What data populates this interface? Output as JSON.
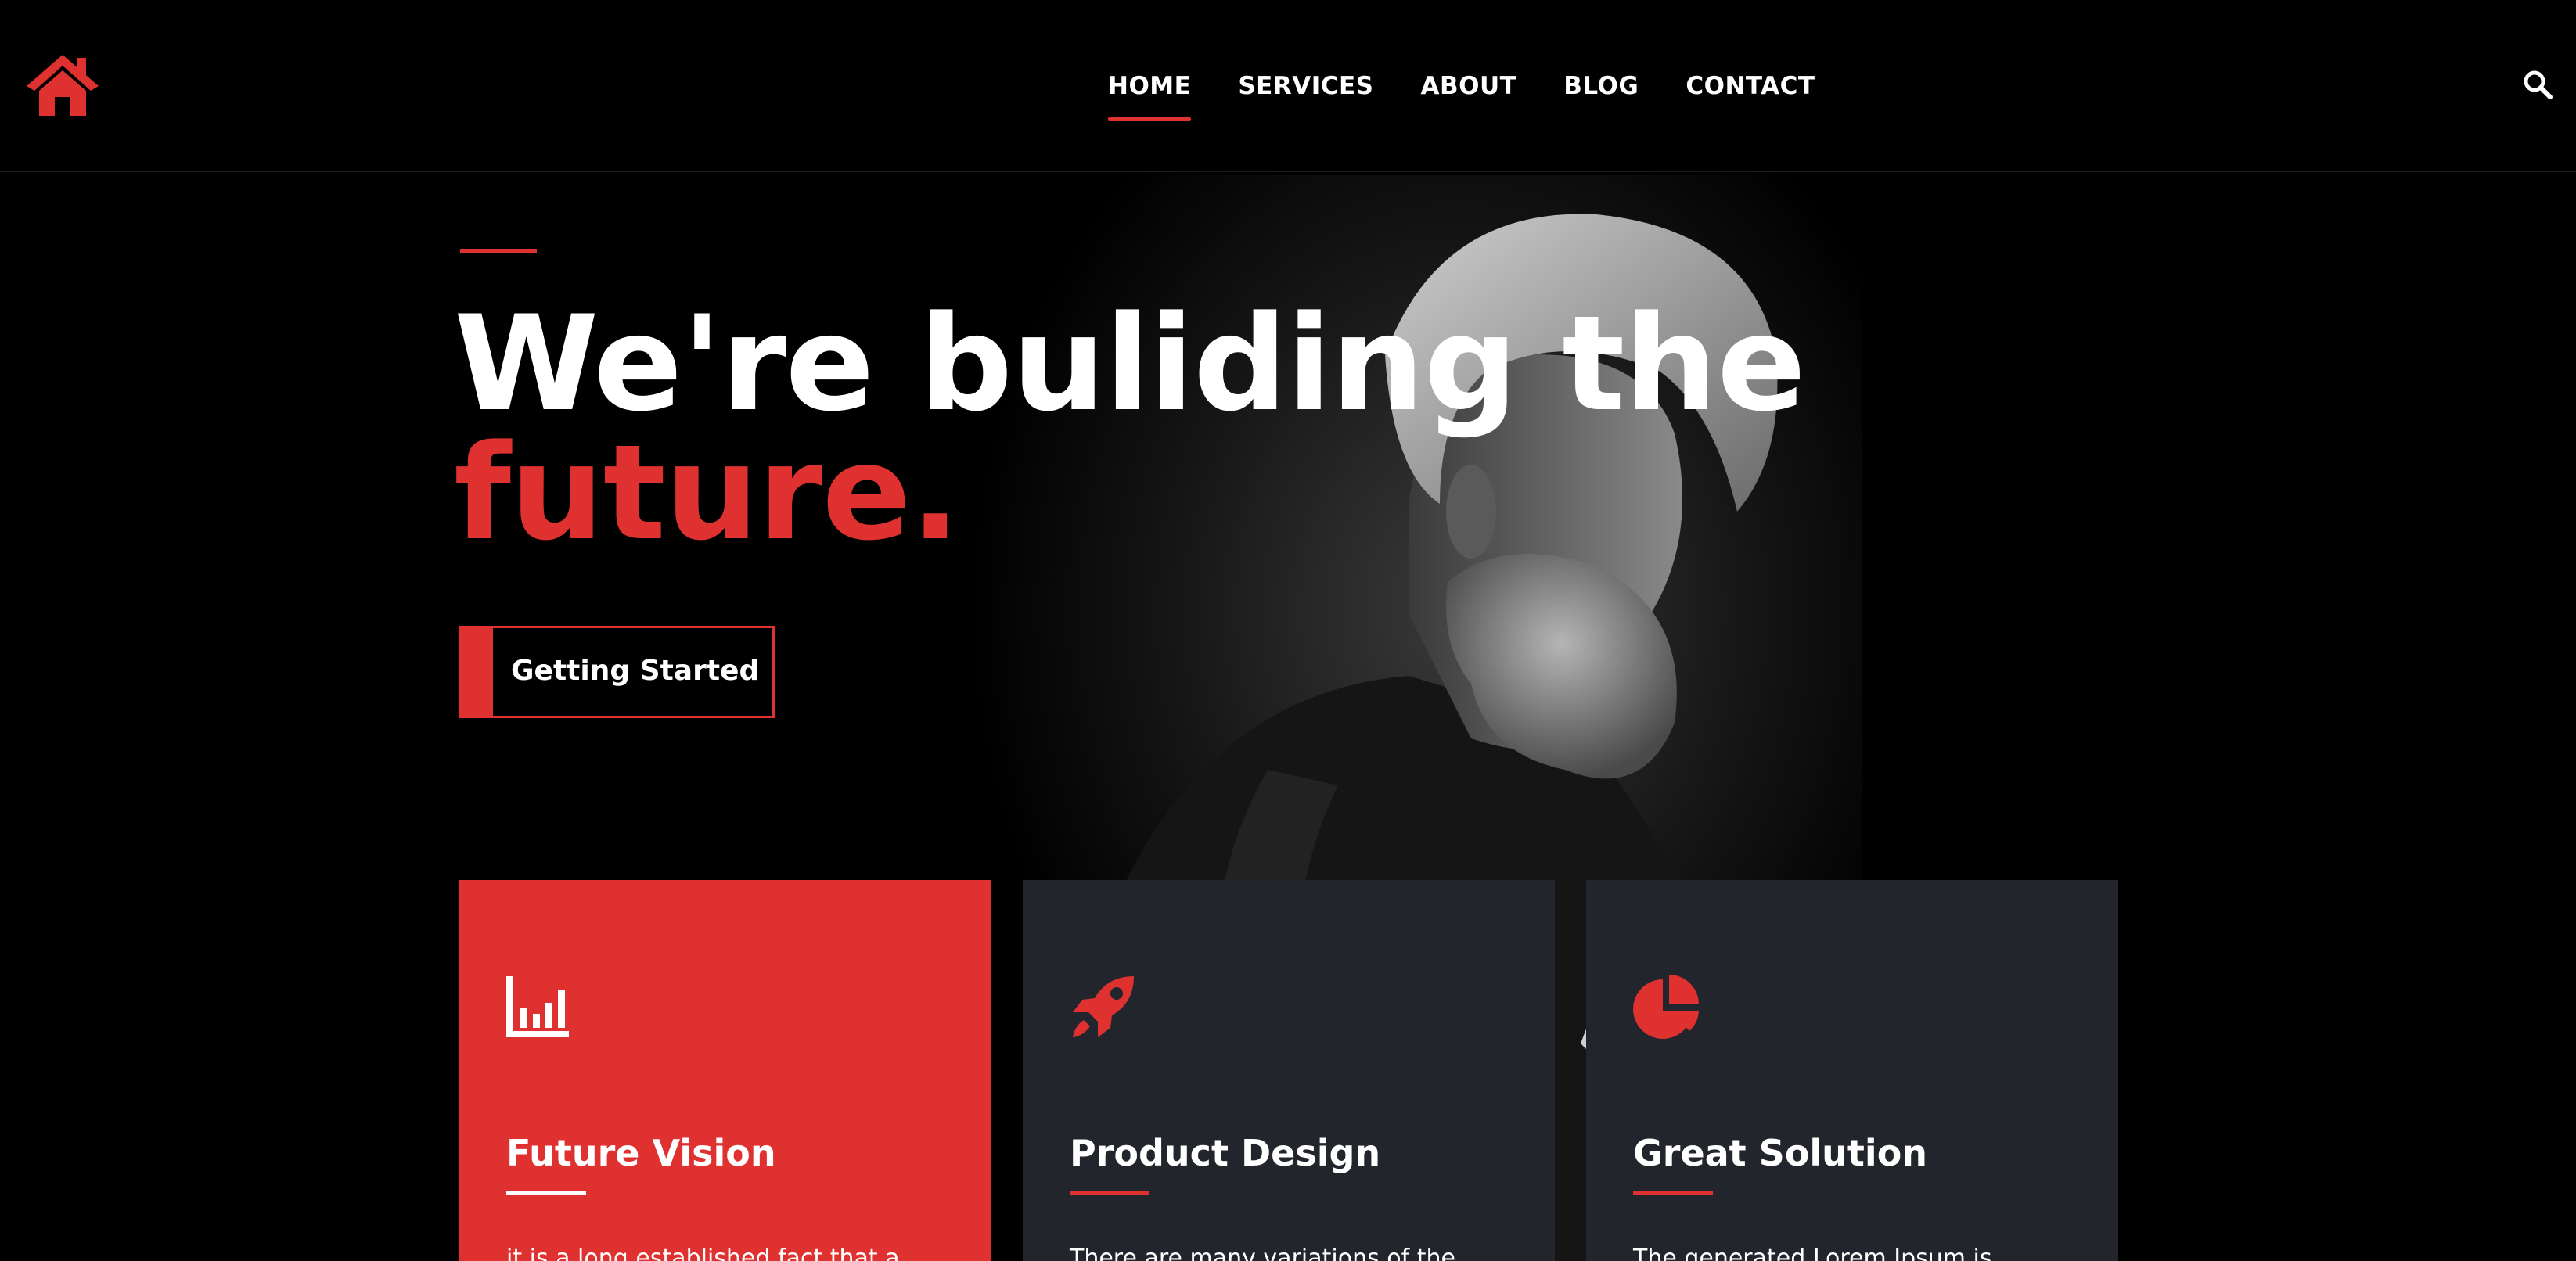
{
  "colors": {
    "accent": "#e03131",
    "background": "#000000",
    "card_dark": "#23252d",
    "text": "#ffffff"
  },
  "header": {
    "logo_icon": "house-icon",
    "nav": [
      {
        "label": "HOME",
        "active": true
      },
      {
        "label": "SERVICES",
        "active": false
      },
      {
        "label": "ABOUT",
        "active": false
      },
      {
        "label": "BLOG",
        "active": false
      },
      {
        "label": "CONTACT",
        "active": false
      }
    ],
    "search_icon": "search-icon"
  },
  "hero": {
    "line1": "We're buliding the",
    "line2": "future.",
    "cta_label": "Getting Started"
  },
  "cards": [
    {
      "icon": "bar-chart-icon",
      "title": "Future Vision",
      "text": "it is a long established fact that a"
    },
    {
      "icon": "rocket-icon",
      "title": "Product Design",
      "text": "There are many variations of the"
    },
    {
      "icon": "pie-chart-icon",
      "title": "Great Solution",
      "text": "The generated Lorem Ipsum is"
    }
  ]
}
